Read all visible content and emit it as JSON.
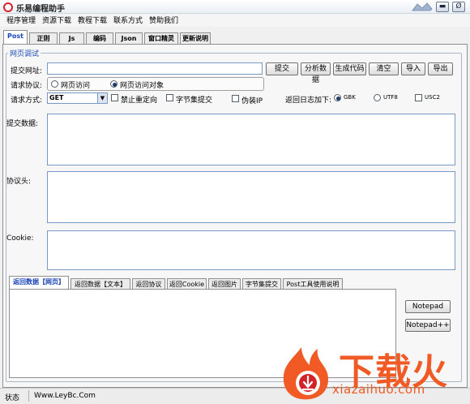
{
  "window": {
    "title": "乐易编程助手",
    "min_symbol": "▬",
    "close_symbol": "Ø"
  },
  "menu": [
    "程序管理",
    "资源下载",
    "教程下载",
    "联系方式",
    "赞助我们"
  ],
  "tabs": [
    "Post",
    "正则",
    "Js",
    "编码",
    "Json",
    "窗口精灵",
    "更新说明"
  ],
  "group_title": "网页调试",
  "url": {
    "label": "提交网址:",
    "value": ""
  },
  "buttons": {
    "submit": "提交",
    "analyze": "分析数据",
    "gen_code": "生成代码",
    "clear": "清空",
    "import": "导入",
    "export": "导出"
  },
  "protocol": {
    "label": "请求协议:",
    "options": [
      "网页访问",
      "网页访问对象"
    ],
    "selected": 1
  },
  "method": {
    "label": "请求方式:",
    "value": "GET",
    "arrow": "▼"
  },
  "checks": {
    "no_redirect": "禁止重定向",
    "byte_submit": "字节集提交",
    "fake_ip": "伪装IP"
  },
  "log_encoding": {
    "label": "返回日志加下:",
    "options": [
      "GBK",
      "UTF8",
      "USC2"
    ],
    "selected": 0
  },
  "fields": {
    "post_data": "提交数据:",
    "headers": "协议头:",
    "cookie": "Cookie:"
  },
  "result_tabs": [
    "返回数据【网页】",
    "返回数据【文本】",
    "返回协议",
    "返回Cookie",
    "返回图片",
    "字节集提交",
    "Post工具使用说明"
  ],
  "side_buttons": [
    "Notepad",
    "Notepad++"
  ],
  "status": {
    "label": "状态",
    "site": "Www.LeyBc.Com"
  },
  "watermark": {
    "brand": "下载火",
    "domain": "xiazaihuo.com"
  },
  "colors": {
    "accent_blue": "#1b46b8",
    "brand_orange": "#f15a24",
    "brand_red": "#d2232a"
  }
}
